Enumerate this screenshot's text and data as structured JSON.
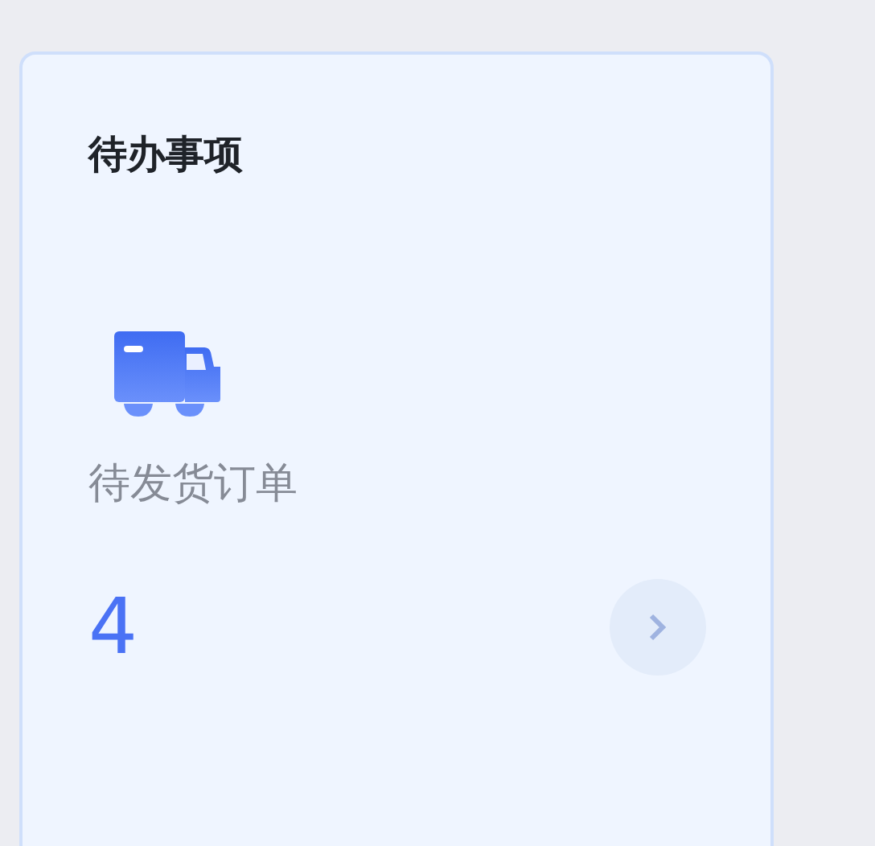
{
  "card": {
    "title": "待办事项",
    "item": {
      "label": "待发货订单",
      "count": "4"
    }
  }
}
